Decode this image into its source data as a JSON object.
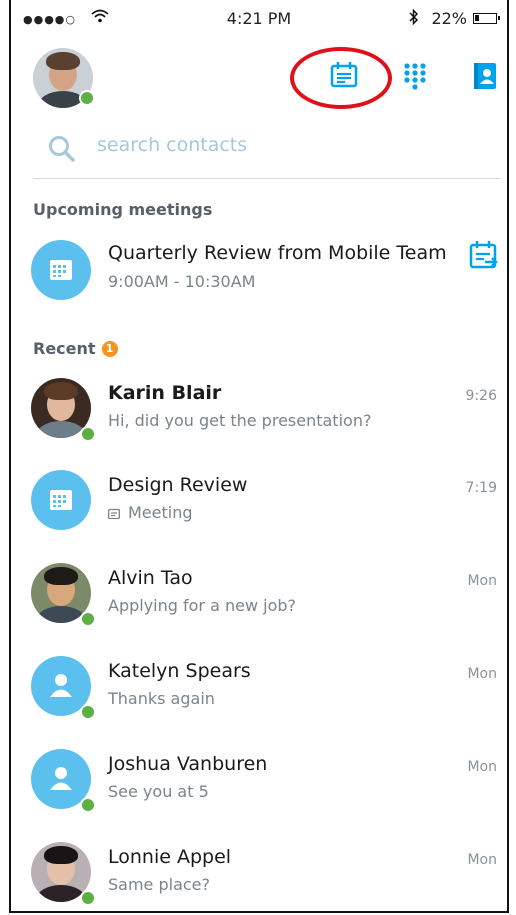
{
  "status_bar": {
    "signal": "●●●●○",
    "time": "4:21 PM",
    "bluetooth": "∗",
    "battery_percent": "22%",
    "battery_level": 0.22
  },
  "header": {
    "meetings_icon": "calendar-meeting-icon",
    "dialpad_icon": "dialpad-icon",
    "contacts_icon": "contacts-icon",
    "highlight_color": "#e0101a"
  },
  "search": {
    "placeholder": "search contacts"
  },
  "upcoming": {
    "heading": "Upcoming meetings",
    "meetings": [
      {
        "title": "Quarterly Review from Mobile Team",
        "time": "9:00AM - 10:30AM"
      }
    ]
  },
  "recent": {
    "heading": "Recent",
    "badge": "1",
    "items": [
      {
        "name": "Karin Blair",
        "message": "Hi, did you get the presentation?",
        "time": "9:26"
      },
      {
        "name": "Design Review",
        "message": "Meeting",
        "time": "7:19"
      },
      {
        "name": "Alvin Tao",
        "message": "Applying for a new job?",
        "time": "Mon"
      },
      {
        "name": "Katelyn Spears",
        "message": "Thanks again",
        "time": "Mon"
      },
      {
        "name": "Joshua Vanburen",
        "message": "See you at 5",
        "time": "Mon"
      },
      {
        "name": "Lonnie Appel",
        "message": "Same place?",
        "time": "Mon"
      }
    ]
  },
  "colors": {
    "accent": "#00a2ed",
    "avatar_blue": "#5cc0ee",
    "presence": "#5db043",
    "badge": "#f7941d"
  }
}
